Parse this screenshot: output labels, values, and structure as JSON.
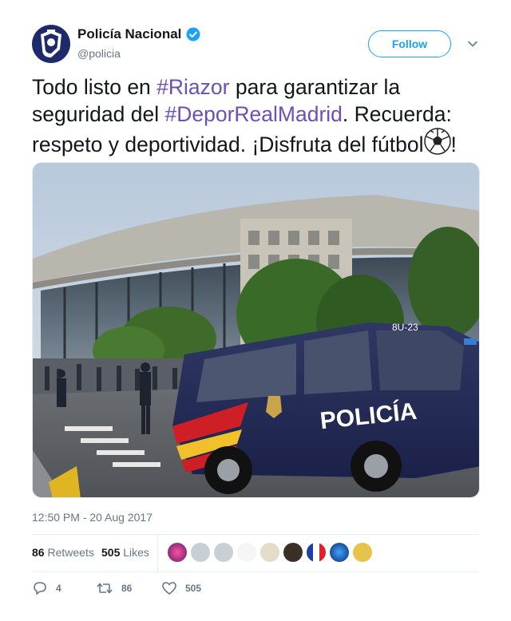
{
  "author": {
    "display_name": "Policía Nacional",
    "handle": "@policia",
    "verified_icon": "verified-badge-icon",
    "avatar_icon": "police-crest-icon"
  },
  "follow": {
    "label": "Follow"
  },
  "tweet": {
    "segments": [
      {
        "text": "Todo listo en ",
        "type": "text"
      },
      {
        "text": "#Riazor",
        "type": "hashtag"
      },
      {
        "text": " para garantizar la seguridad del ",
        "type": "text"
      },
      {
        "text": "#DeporRealMadrid",
        "type": "hashtag"
      },
      {
        "text": ". Recuerda: respeto y deportividad. ¡Disfruta del fútbol",
        "type": "text"
      },
      {
        "text": "!",
        "type": "text"
      }
    ],
    "emoji_icon": "soccer-ball-icon"
  },
  "media": {
    "van_text": "POLICÍA",
    "van_code": "8U-23"
  },
  "timestamp": "12:50 PM - 20 Aug 2017",
  "stats": {
    "retweets_count": "86",
    "retweets_label": "Retweets",
    "likes_count": "505",
    "likes_label": "Likes"
  },
  "actions": {
    "reply_count": "4",
    "retweet_count": "86",
    "like_count": "505"
  },
  "colors": {
    "accent": "#1da1f2",
    "hashtag": "#6e4fb8",
    "muted": "#657786"
  }
}
